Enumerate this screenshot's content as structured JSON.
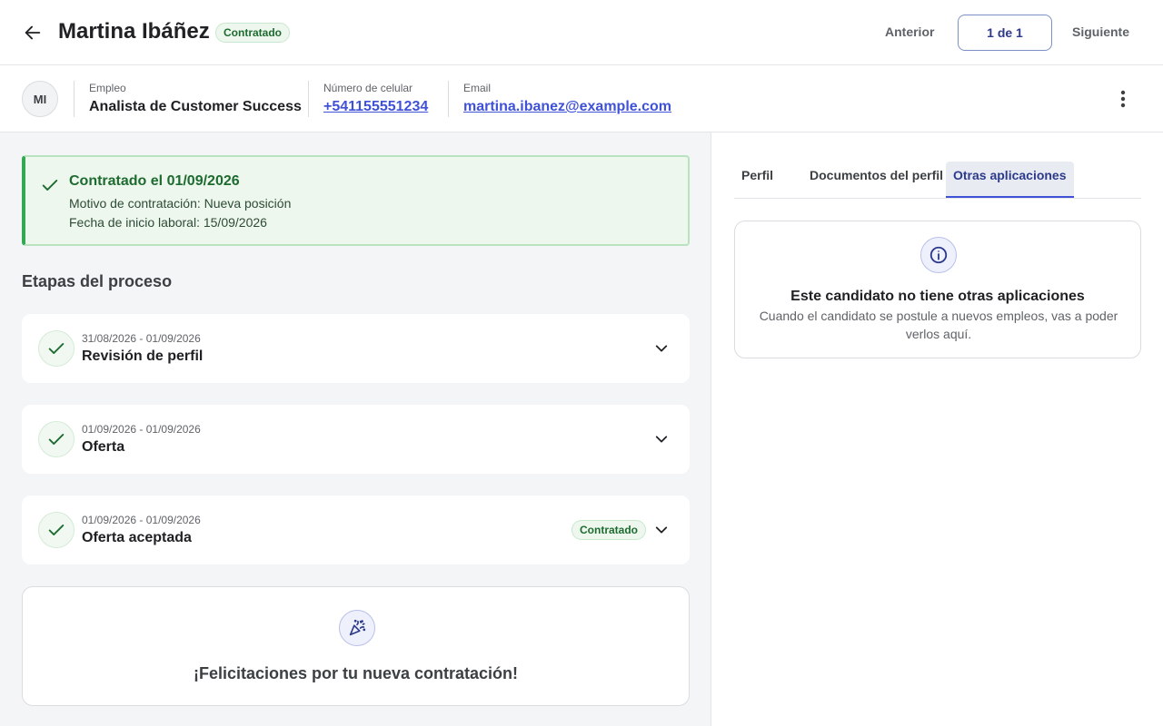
{
  "header": {
    "candidate_name": "Martina Ibáñez",
    "status_badge": "Contratado",
    "prev_label": "Anterior",
    "counter": "1 de 1",
    "next_label": "Siguiente"
  },
  "info": {
    "avatar_initials": "MI",
    "job_label": "Empleo",
    "job_value": "Analista de Customer Success",
    "phone_label": "Número de celular",
    "phone_value": "+541155551234",
    "email_label": "Email",
    "email_value": "martina.ibanez@example.com"
  },
  "hired_banner": {
    "title": "Contratado el 01/09/2026",
    "reason": "Motivo de contratación: Nueva posición",
    "start_date": "Fecha de inicio laboral: 15/09/2026"
  },
  "stages": {
    "title": "Etapas del proceso",
    "items": [
      {
        "dates": "31/08/2026 - 01/09/2026",
        "name": "Revisión de perfil",
        "badge": ""
      },
      {
        "dates": "01/09/2026 - 01/09/2026",
        "name": "Oferta",
        "badge": ""
      },
      {
        "dates": "01/09/2026 - 01/09/2026",
        "name": "Oferta aceptada",
        "badge": "Contratado"
      }
    ]
  },
  "congrats": {
    "message": "¡Felicitaciones por tu nueva contratación!"
  },
  "right_panel": {
    "tabs": [
      {
        "label": "Perfil"
      },
      {
        "label": "Documentos del perfil"
      },
      {
        "label": "Otras aplicaciones"
      }
    ],
    "active_tab": "Otras aplicaciones",
    "empty_title": "Este candidato no tiene otras aplicaciones",
    "empty_description": "Cuando el candidato se postule a nuevos empleos, vas a poder verlos aquí."
  },
  "colors": {
    "success_green": "#34a853",
    "accent_blue": "#3f51d6",
    "panel_bg": "#f4f5f7"
  },
  "icons": {
    "back": "arrow-left-icon",
    "more": "more-vertical-icon",
    "check": "check-icon",
    "chevron": "chevron-down-icon",
    "party": "party-popper-icon",
    "info": "info-icon"
  }
}
